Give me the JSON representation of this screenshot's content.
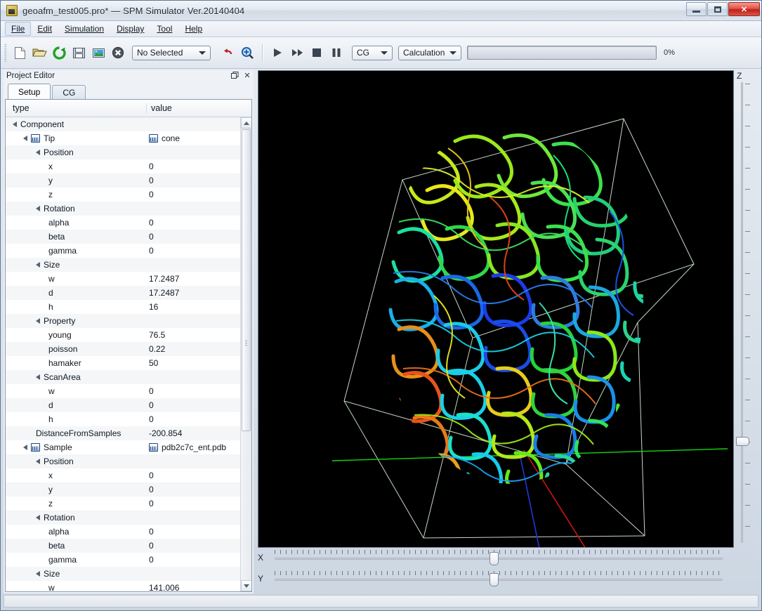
{
  "window": {
    "title": "geoafm_test005.pro* — SPM Simulator Ver.20140404",
    "icon": "folder-icon",
    "controls": {
      "minimize": "minimize-icon",
      "maximize": "maximize-icon",
      "close": "✕"
    }
  },
  "menubar": {
    "items": [
      {
        "label": "File",
        "active": true
      },
      {
        "label": "Edit",
        "active": false
      },
      {
        "label": "Simulation",
        "active": false
      },
      {
        "label": "Display",
        "active": false
      },
      {
        "label": "Tool",
        "active": false
      },
      {
        "label": "Help",
        "active": false
      }
    ]
  },
  "toolbar": {
    "buttons": [
      {
        "name": "new-file-icon"
      },
      {
        "name": "open-folder-icon"
      },
      {
        "name": "reload-icon"
      },
      {
        "name": "save-icon"
      },
      {
        "name": "image-icon"
      },
      {
        "name": "cancel-icon"
      }
    ],
    "selection_combo": {
      "value": "No Selected",
      "name": "selection-dropdown"
    },
    "undo": {
      "name": "undo-icon"
    },
    "zoom": {
      "name": "zoom-in-icon"
    },
    "transport": [
      {
        "name": "play-button"
      },
      {
        "name": "fast-forward-button"
      },
      {
        "name": "stop-button"
      },
      {
        "name": "pause-button"
      }
    ],
    "mode_combo": {
      "value": "CG",
      "name": "mode-dropdown"
    },
    "task_combo": {
      "value": "Calculation",
      "name": "task-dropdown"
    },
    "progress": {
      "percent_label": "0%",
      "value": 0
    }
  },
  "dock": {
    "title": "Project Editor",
    "float_button": "restore-icon",
    "close_button": "✕",
    "tabs": [
      {
        "label": "Setup",
        "selected": true
      },
      {
        "label": "CG",
        "selected": false
      }
    ]
  },
  "tree": {
    "headers": {
      "type": "type",
      "value": "value"
    },
    "rows": [
      {
        "label": "Component",
        "value": "",
        "indent": 0,
        "twisty": true,
        "icon": false
      },
      {
        "label": "Tip",
        "value": "cone",
        "indent": 1,
        "twisty": true,
        "icon": true,
        "value_icon": true
      },
      {
        "label": "Position",
        "value": "",
        "indent": 2,
        "twisty": true,
        "icon": false
      },
      {
        "label": "x",
        "value": "0",
        "indent": 3,
        "twisty": false,
        "icon": false
      },
      {
        "label": "y",
        "value": "0",
        "indent": 3,
        "twisty": false,
        "icon": false
      },
      {
        "label": "z",
        "value": "0",
        "indent": 3,
        "twisty": false,
        "icon": false
      },
      {
        "label": "Rotation",
        "value": "",
        "indent": 2,
        "twisty": true,
        "icon": false
      },
      {
        "label": "alpha",
        "value": "0",
        "indent": 3,
        "twisty": false,
        "icon": false
      },
      {
        "label": "beta",
        "value": "0",
        "indent": 3,
        "twisty": false,
        "icon": false
      },
      {
        "label": "gamma",
        "value": "0",
        "indent": 3,
        "twisty": false,
        "icon": false
      },
      {
        "label": "Size",
        "value": "",
        "indent": 2,
        "twisty": true,
        "icon": false
      },
      {
        "label": "w",
        "value": "17.2487",
        "indent": 3,
        "twisty": false,
        "icon": false
      },
      {
        "label": "d",
        "value": "17.2487",
        "indent": 3,
        "twisty": false,
        "icon": false
      },
      {
        "label": "h",
        "value": "16",
        "indent": 3,
        "twisty": false,
        "icon": false
      },
      {
        "label": "Property",
        "value": "",
        "indent": 2,
        "twisty": true,
        "icon": false
      },
      {
        "label": "young",
        "value": "76.5",
        "indent": 3,
        "twisty": false,
        "icon": false
      },
      {
        "label": "poisson",
        "value": "0.22",
        "indent": 3,
        "twisty": false,
        "icon": false
      },
      {
        "label": "hamaker",
        "value": "50",
        "indent": 3,
        "twisty": false,
        "icon": false
      },
      {
        "label": "ScanArea",
        "value": "",
        "indent": 2,
        "twisty": true,
        "icon": false
      },
      {
        "label": "w",
        "value": "0",
        "indent": 3,
        "twisty": false,
        "icon": false
      },
      {
        "label": "d",
        "value": "0",
        "indent": 3,
        "twisty": false,
        "icon": false
      },
      {
        "label": "h",
        "value": "0",
        "indent": 3,
        "twisty": false,
        "icon": false
      },
      {
        "label": "DistanceFromSamples",
        "value": "-200.854",
        "indent": 2,
        "twisty": false,
        "icon": false
      },
      {
        "label": "Sample",
        "value": "pdb2c7c_ent.pdb",
        "indent": 1,
        "twisty": true,
        "icon": true,
        "value_icon": true
      },
      {
        "label": "Position",
        "value": "",
        "indent": 2,
        "twisty": true,
        "icon": false
      },
      {
        "label": "x",
        "value": "0",
        "indent": 3,
        "twisty": false,
        "icon": false
      },
      {
        "label": "y",
        "value": "0",
        "indent": 3,
        "twisty": false,
        "icon": false
      },
      {
        "label": "z",
        "value": "0",
        "indent": 3,
        "twisty": false,
        "icon": false
      },
      {
        "label": "Rotation",
        "value": "",
        "indent": 2,
        "twisty": true,
        "icon": false
      },
      {
        "label": "alpha",
        "value": "0",
        "indent": 3,
        "twisty": false,
        "icon": false
      },
      {
        "label": "beta",
        "value": "0",
        "indent": 3,
        "twisty": false,
        "icon": false
      },
      {
        "label": "gamma",
        "value": "0",
        "indent": 3,
        "twisty": false,
        "icon": false
      },
      {
        "label": "Size",
        "value": "",
        "indent": 2,
        "twisty": true,
        "icon": false
      },
      {
        "label": "w",
        "value": "141.006",
        "indent": 3,
        "twisty": false,
        "icon": false
      }
    ]
  },
  "viewport": {
    "name": "3d-molecule-viewport",
    "background": "#000000",
    "box_color": "#cfe8cf",
    "axis_colors": {
      "x": "#e01414",
      "y": "#1e38d8",
      "z": "#14d814"
    },
    "molecule": "protein ribbon model, rainbow-colored by chain"
  },
  "sliders": {
    "x": {
      "label": "X",
      "value": 48,
      "name": "x-slider"
    },
    "y": {
      "label": "Y",
      "value": 48,
      "name": "y-slider"
    },
    "z": {
      "label": "Z",
      "value": 20,
      "name": "z-slider"
    }
  }
}
